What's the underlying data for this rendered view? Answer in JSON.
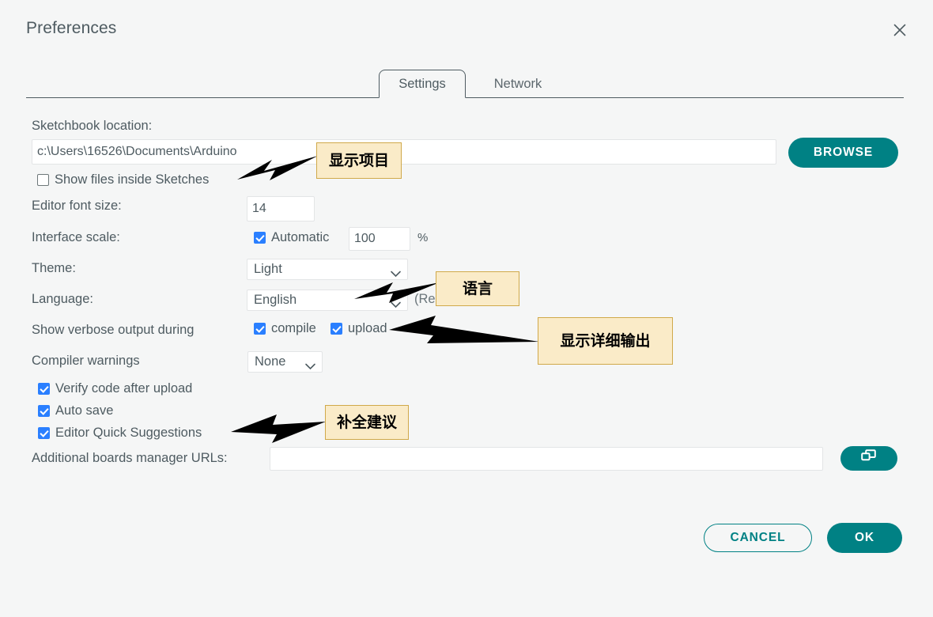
{
  "window": {
    "title": "Preferences",
    "close_icon": "close-icon"
  },
  "tabs": [
    {
      "label": "Settings",
      "active": true
    },
    {
      "label": "Network",
      "active": false
    }
  ],
  "settings": {
    "sketchbook_label": "Sketchbook location:",
    "sketchbook_value": "c:\\Users\\16526\\Documents\\Arduino",
    "browse_label": "BROWSE",
    "show_files_label": "Show files inside Sketches",
    "show_files_checked": false,
    "editor_font_size_label": "Editor font size:",
    "editor_font_size_value": "14",
    "interface_scale_label": "Interface scale:",
    "automatic_label": "Automatic",
    "automatic_checked": true,
    "scale_value": "100",
    "percent_label": "%",
    "theme_label": "Theme:",
    "theme_value": "Light",
    "language_label": "Language:",
    "language_value": "English",
    "reload_note": "(Reload required)",
    "verbose_label": "Show verbose output during",
    "compile_label": "compile",
    "compile_checked": true,
    "upload_label": "upload",
    "upload_checked": true,
    "compiler_warnings_label": "Compiler warnings",
    "compiler_warnings_value": "None",
    "verify_label": "Verify code after upload",
    "verify_checked": true,
    "autosave_label": "Auto save",
    "autosave_checked": true,
    "quick_suggestions_label": "Editor Quick Suggestions",
    "quick_suggestions_checked": true,
    "boards_urls_label": "Additional boards manager URLs:",
    "boards_urls_value": "",
    "boards_urls_button_icon": "open-window-icon"
  },
  "footer": {
    "cancel_label": "CANCEL",
    "ok_label": "OK"
  },
  "annotations": [
    {
      "text": "显示项目"
    },
    {
      "text": "语言"
    },
    {
      "text": "显示详细输出"
    },
    {
      "text": "补全建议"
    }
  ],
  "colors": {
    "accent": "#008184",
    "checkbox": "#2a7fff",
    "annotation_fill": "#faebc8",
    "annotation_border": "#d0a94a",
    "background": "#f5f6f6",
    "text": "#4e5b61"
  }
}
